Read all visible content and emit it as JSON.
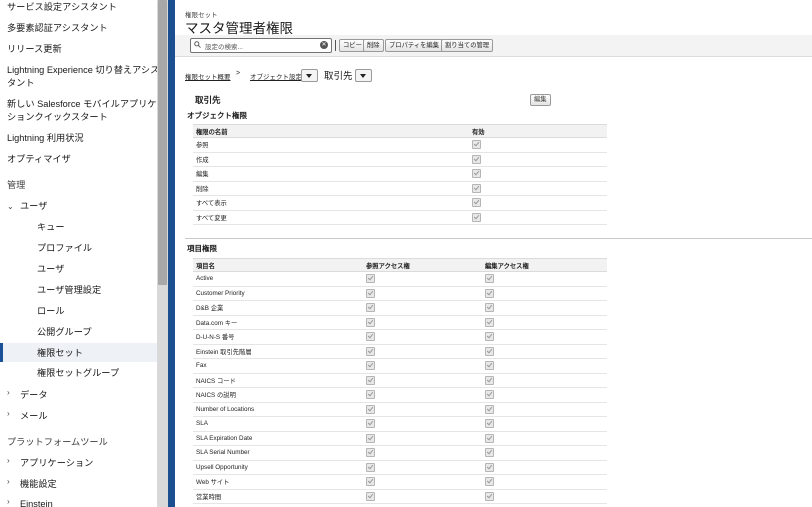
{
  "sidebar": {
    "items": [
      {
        "label": "サービス設定アシスタント"
      },
      {
        "label": "多要素認証アシスタント"
      },
      {
        "label": "リリース更新"
      },
      {
        "label": "Lightning Experience 切り替えアシス"
      },
      {
        "label": "タント"
      },
      {
        "label": "新しい Salesforce モバイルアプリケー"
      },
      {
        "label": "ションクイックスタート"
      },
      {
        "label": "Lightning 利用状況"
      },
      {
        "label": "オプティマイザ"
      },
      {
        "label": "管理"
      },
      {
        "label": "ユーザ"
      },
      {
        "label": "キュー"
      },
      {
        "label": "プロファイル"
      },
      {
        "label": "ユーザ"
      },
      {
        "label": "ユーザ管理設定"
      },
      {
        "label": "ロール"
      },
      {
        "label": "公開グループ"
      },
      {
        "label": "権限セット"
      },
      {
        "label": "権限セットグループ"
      },
      {
        "label": "データ"
      },
      {
        "label": "メール"
      },
      {
        "label": "プラットフォームツール"
      },
      {
        "label": "アプリケーション"
      },
      {
        "label": "機能設定"
      },
      {
        "label": "Einstein"
      }
    ]
  },
  "header": {
    "eyebrow": "権限セット",
    "title": "マスタ管理者権限"
  },
  "toolbar": {
    "search_placeholder": "設定の検索...",
    "clear_symbol": "✕",
    "buttons": [
      "コピー",
      "削除",
      "プロパティを編集",
      "割り当ての管理"
    ]
  },
  "breadcrumb": {
    "overview": "権限セット概要",
    "sep": ">",
    "object_settings": "オブジェクト設定",
    "current": "取引先"
  },
  "object": {
    "title": "取引先",
    "edit_label": "編集"
  },
  "object_permissions": {
    "title": "オブジェクト権限",
    "headers": [
      "権限の名前",
      "有効"
    ],
    "rows": [
      {
        "name": "参照",
        "enabled": true
      },
      {
        "name": "作成",
        "enabled": true
      },
      {
        "name": "編集",
        "enabled": true
      },
      {
        "name": "削除",
        "enabled": true
      },
      {
        "name": "すべて表示",
        "enabled": true
      },
      {
        "name": "すべて変更",
        "enabled": true
      }
    ]
  },
  "field_permissions": {
    "title": "項目権限",
    "headers": [
      "項目名",
      "参照アクセス権",
      "編集アクセス権"
    ],
    "rows": [
      {
        "name": "Active"
      },
      {
        "name": "Customer Priority"
      },
      {
        "name": "D&B 企業"
      },
      {
        "name": "Data.com キー"
      },
      {
        "name": "D-U-N-S 番号"
      },
      {
        "name": "Einstein 取引先階層"
      },
      {
        "name": "Fax"
      },
      {
        "name": "NAICS コード"
      },
      {
        "name": "NAICS の説明"
      },
      {
        "name": "Number of Locations"
      },
      {
        "name": "SLA"
      },
      {
        "name": "SLA Expiration Date"
      },
      {
        "name": "SLA Serial Number"
      },
      {
        "name": "Upsell Opportunity"
      },
      {
        "name": "Web サイト"
      },
      {
        "name": "営業時間"
      }
    ]
  },
  "colors": {
    "accent": "#1b4f8f",
    "selected_bg": "#eef1f6"
  }
}
